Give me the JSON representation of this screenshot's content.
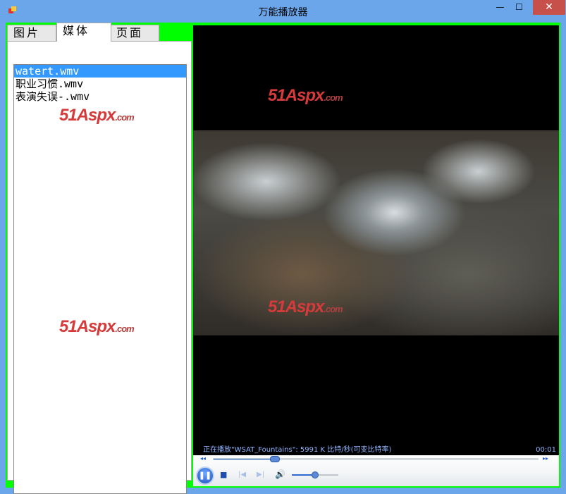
{
  "window": {
    "title": "万能播放器",
    "minimize": "—",
    "maximize": "☐",
    "close": "✕"
  },
  "tabs": [
    {
      "label": "图片"
    },
    {
      "label": "媒体"
    },
    {
      "label": "页面"
    }
  ],
  "playlist": {
    "items": [
      "watert.wmv",
      "职业习惯.wmv",
      "表演失误-.wmv"
    ],
    "selected_index": 0
  },
  "watermark": {
    "main": "51Aspx",
    "suffix": ".com"
  },
  "player": {
    "status": "正在播放\"WSAT_Fountains\": 5991 K 比特/秒(可变比特率)",
    "time": "00:01",
    "seek_fraction": 0.19,
    "volume_fraction": 0.5,
    "icons": {
      "rewind": "◂◂",
      "forward": "▸▸",
      "pause": "❚❚",
      "stop": "■",
      "prev": "|◀",
      "next": "▶|",
      "volume": "🔊"
    }
  }
}
